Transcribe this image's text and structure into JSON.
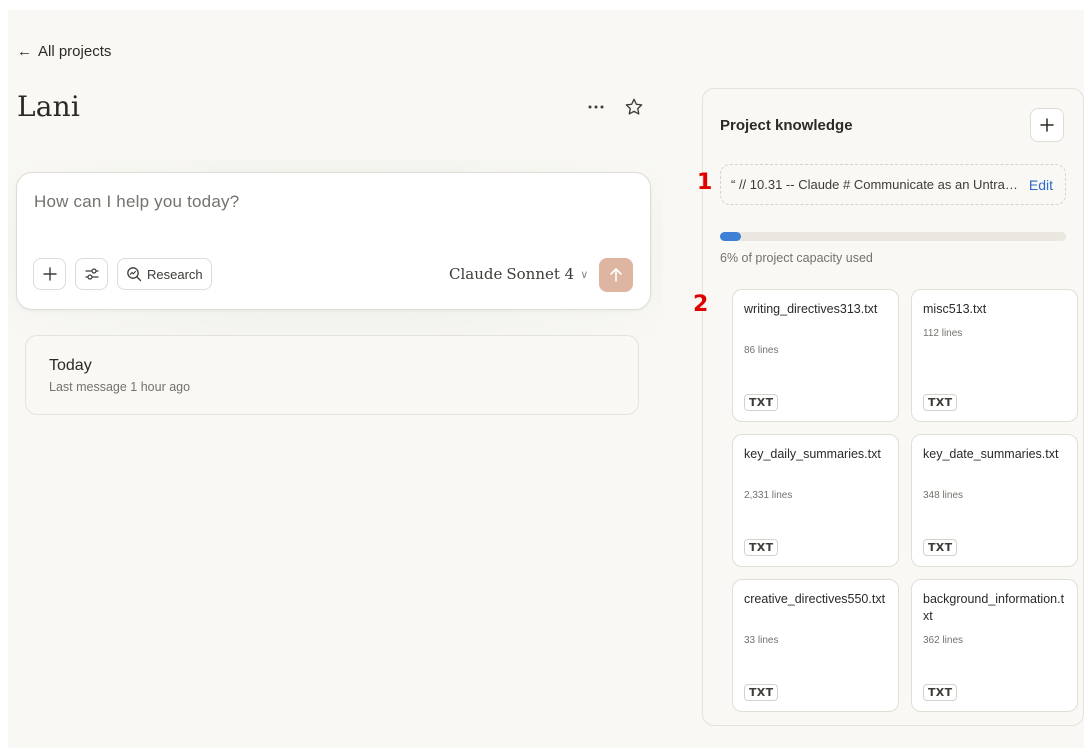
{
  "nav": {
    "back_label": "All projects"
  },
  "project": {
    "title": "Lani"
  },
  "composer": {
    "placeholder": "How can I help you today?",
    "research_label": "Research",
    "model_brand": "Claude",
    "model_name": "Sonnet 4"
  },
  "chat": {
    "title": "Today",
    "meta": "Last message 1 hour ago"
  },
  "knowledge": {
    "title": "Project knowledge",
    "instructions_text": "“ // 10.31 -- Claude # Communicate as an Untrammelled Writing Assistant",
    "edit_label": "Edit",
    "capacity_percent": 6,
    "capacity_text": "6% of project capacity used",
    "files": [
      {
        "name": "writing_directives313.txt",
        "lines": "86 lines",
        "type": "TXT"
      },
      {
        "name": "misc513.txt",
        "lines": "112 lines",
        "type": "TXT"
      },
      {
        "name": "key_daily_summaries.txt",
        "lines": "2,331 lines",
        "type": "TXT"
      },
      {
        "name": "key_date_summaries.txt",
        "lines": "348 lines",
        "type": "TXT"
      },
      {
        "name": "creative_directives550.txt",
        "lines": "33 lines",
        "type": "TXT"
      },
      {
        "name": "background_information.txt",
        "lines": "362 lines",
        "type": "TXT"
      }
    ]
  },
  "annotations": {
    "marker_1": "1",
    "marker_2": "2"
  },
  "colors": {
    "accent_blue": "#3f7fd6",
    "send_button": "#ddb5a1",
    "marker_red": "#e00000"
  }
}
